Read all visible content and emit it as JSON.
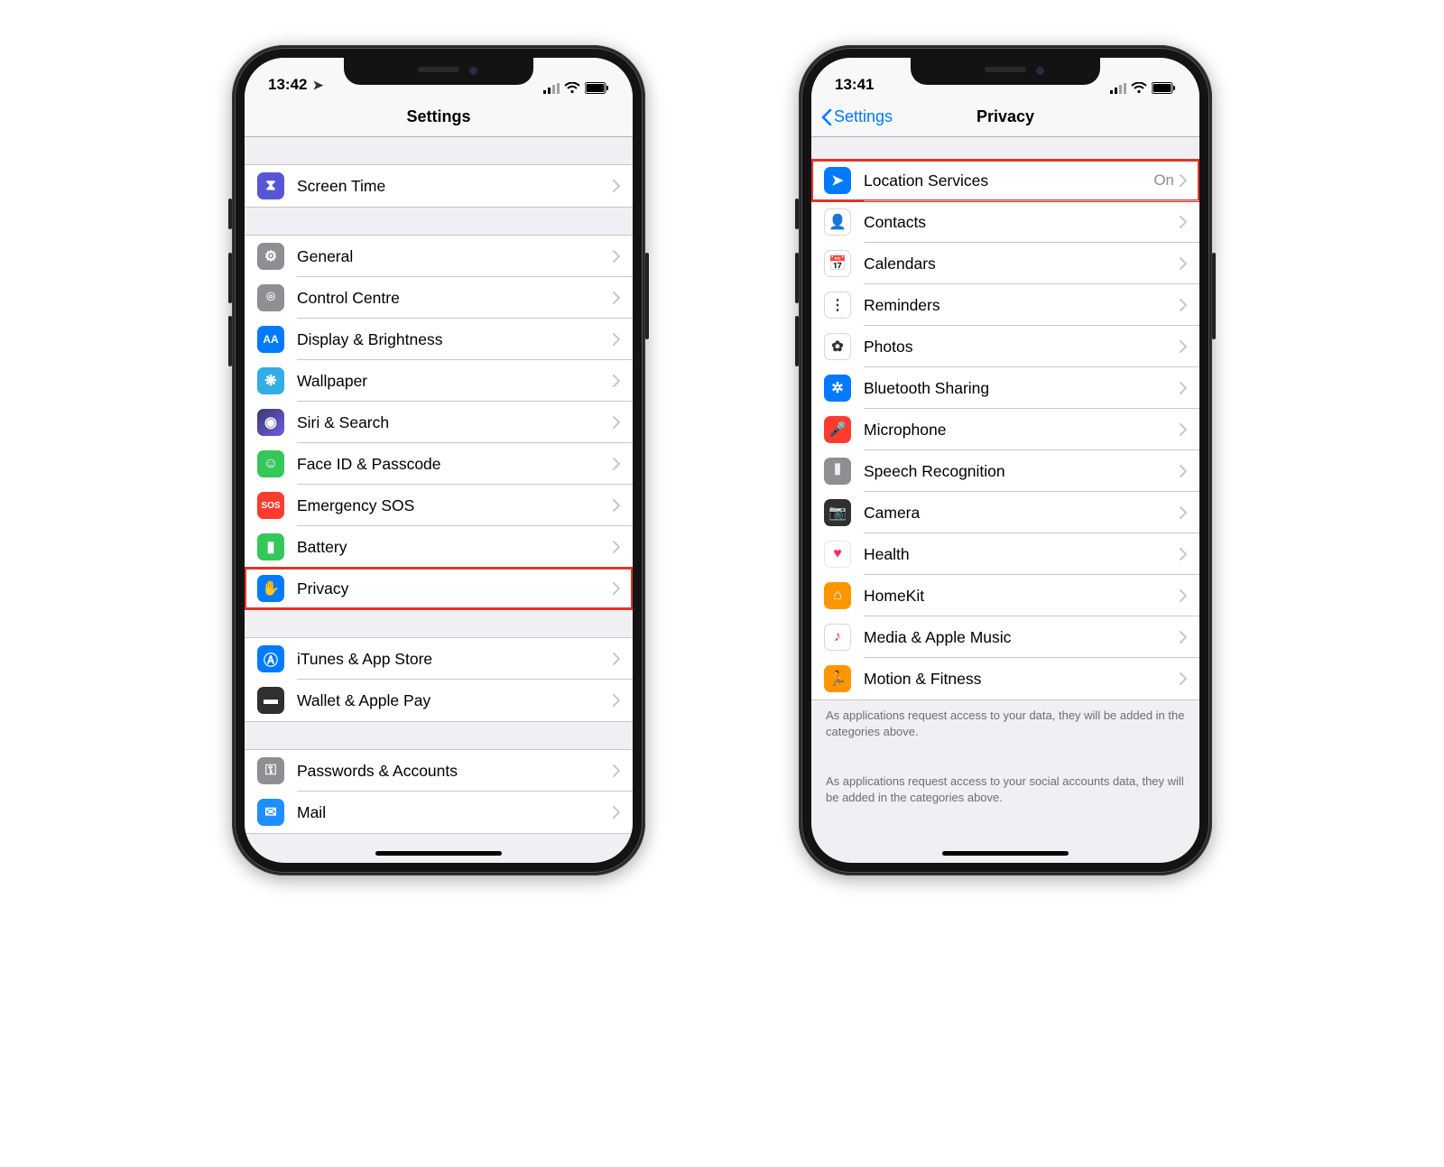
{
  "phone_left": {
    "status": {
      "time": "13:42",
      "has_location_arrow": true
    },
    "nav": {
      "title": "Settings"
    },
    "groups": [
      {
        "cells": [
          {
            "icon": "hourglass-icon",
            "bg": "bg-purple",
            "label": "Screen Time",
            "highlight": false
          }
        ]
      },
      {
        "cells": [
          {
            "icon": "gear-icon",
            "bg": "bg-gray",
            "label": "General"
          },
          {
            "icon": "switches-icon",
            "bg": "bg-gray",
            "label": "Control Centre"
          },
          {
            "icon": "aa-icon",
            "bg": "bg-blue",
            "label": "Display & Brightness"
          },
          {
            "icon": "flower-icon",
            "bg": "bg-cyan",
            "label": "Wallpaper"
          },
          {
            "icon": "siri-icon",
            "bg": "bg-indigo",
            "label": "Siri & Search"
          },
          {
            "icon": "faceid-icon",
            "bg": "bg-green",
            "label": "Face ID & Passcode"
          },
          {
            "icon": "sos-icon",
            "bg": "bg-red",
            "label": "Emergency SOS"
          },
          {
            "icon": "battery-icon",
            "bg": "bg-greenbat",
            "label": "Battery"
          },
          {
            "icon": "hand-icon",
            "bg": "bg-bluep",
            "label": "Privacy",
            "highlight": true
          }
        ]
      },
      {
        "cells": [
          {
            "icon": "appstore-icon",
            "bg": "bg-blue",
            "label": "iTunes & App Store"
          },
          {
            "icon": "wallet-icon",
            "bg": "bg-dark",
            "label": "Wallet & Apple Pay"
          }
        ]
      },
      {
        "cells": [
          {
            "icon": "key-icon",
            "bg": "bg-grayk",
            "label": "Passwords & Accounts"
          },
          {
            "icon": "mail-icon",
            "bg": "bg-mail",
            "label": "Mail"
          }
        ]
      }
    ]
  },
  "phone_right": {
    "status": {
      "time": "13:41",
      "has_location_arrow": false
    },
    "nav": {
      "back": "Settings",
      "title": "Privacy"
    },
    "groups": [
      {
        "cells": [
          {
            "icon": "location-arrow-icon",
            "bg": "bg-blue",
            "label": "Location Services",
            "detail": "On",
            "highlight": true
          },
          {
            "icon": "contacts-icon",
            "bg": "bg-white",
            "label": "Contacts"
          },
          {
            "icon": "calendar-icon",
            "bg": "bg-white",
            "label": "Calendars"
          },
          {
            "icon": "reminders-icon",
            "bg": "bg-white",
            "label": "Reminders"
          },
          {
            "icon": "photos-icon",
            "bg": "bg-white",
            "label": "Photos"
          },
          {
            "icon": "bluetooth-icon",
            "bg": "bg-blue",
            "label": "Bluetooth Sharing"
          },
          {
            "icon": "microphone-icon",
            "bg": "bg-red",
            "label": "Microphone"
          },
          {
            "icon": "waveform-icon",
            "bg": "bg-gray",
            "label": "Speech Recognition"
          },
          {
            "icon": "camera-icon",
            "bg": "bg-dark",
            "label": "Camera"
          },
          {
            "icon": "heart-icon",
            "bg": "bg-pink",
            "label": "Health"
          },
          {
            "icon": "home-icon",
            "bg": "bg-orange",
            "label": "HomeKit"
          },
          {
            "icon": "music-icon",
            "bg": "bg-white",
            "label": "Media & Apple Music"
          },
          {
            "icon": "running-icon",
            "bg": "bg-orange",
            "label": "Motion & Fitness"
          }
        ],
        "footer": "As applications request access to your data, they will be added in the categories above."
      },
      {
        "cells": [],
        "footer": "As applications request access to your social accounts data, they will be added in the categories above."
      }
    ]
  },
  "icons": {
    "hourglass-icon": "⧗",
    "gear-icon": "⚙",
    "switches-icon": "⌾",
    "aa-icon": "AA",
    "flower-icon": "❋",
    "siri-icon": "◉",
    "faceid-icon": "☺",
    "sos-icon": "SOS",
    "battery-icon": "▮",
    "hand-icon": "✋",
    "appstore-icon": "Ⓐ",
    "wallet-icon": "▬",
    "key-icon": "⚿",
    "mail-icon": "✉",
    "location-arrow-icon": "➤",
    "contacts-icon": "👤",
    "calendar-icon": "📅",
    "reminders-icon": "⋮",
    "photos-icon": "✿",
    "bluetooth-icon": "✲",
    "microphone-icon": "🎤",
    "waveform-icon": "⫴",
    "camera-icon": "📷",
    "heart-icon": "♥",
    "home-icon": "⌂",
    "music-icon": "♪",
    "running-icon": "🏃"
  }
}
